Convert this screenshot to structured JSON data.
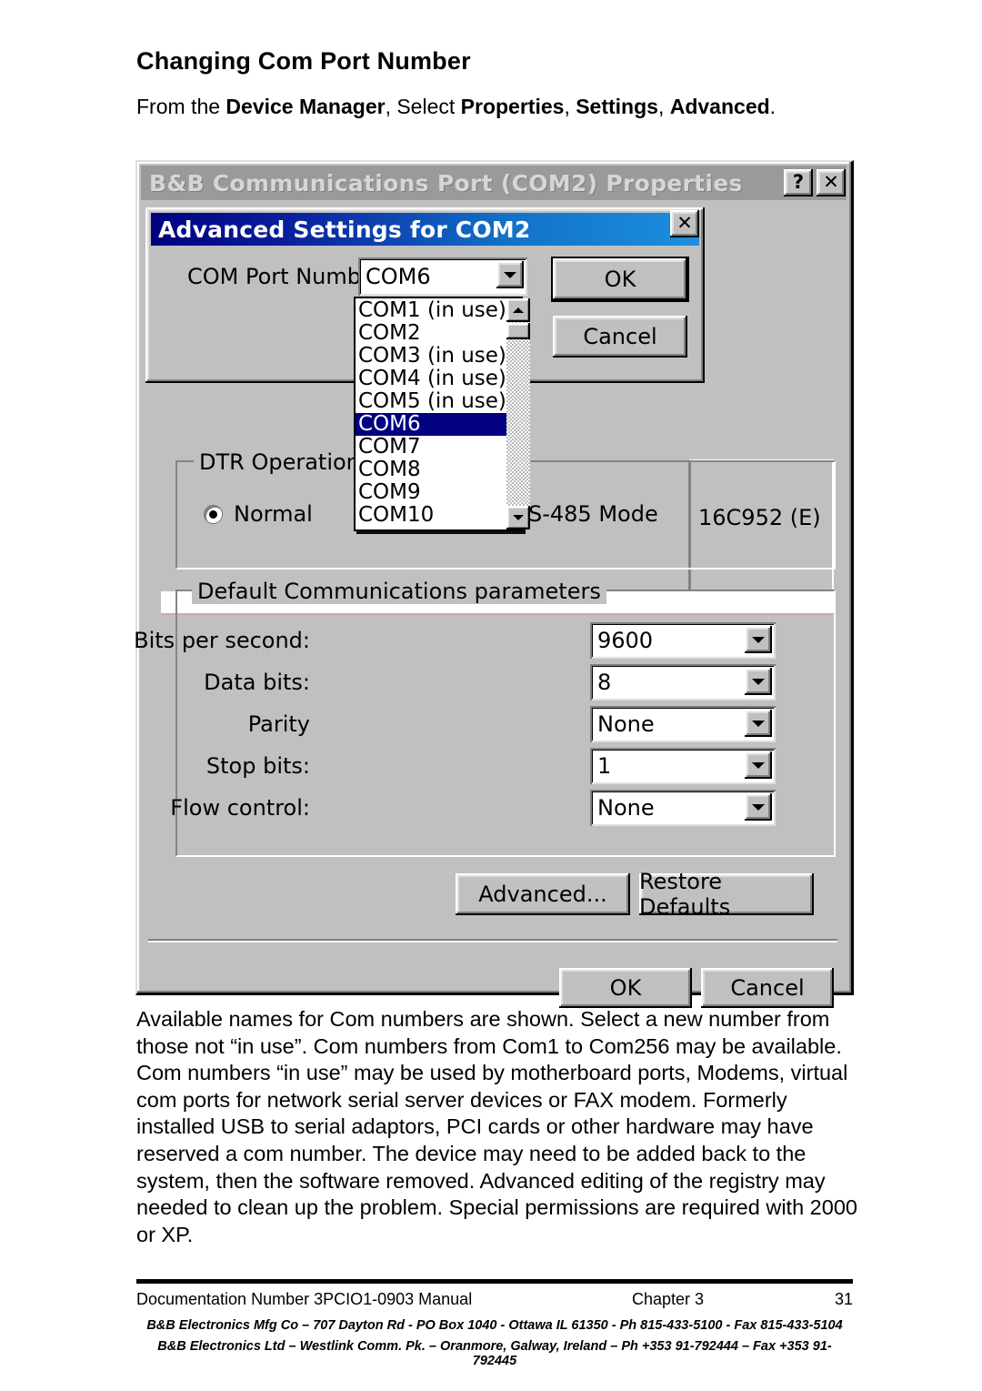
{
  "page": {
    "title": "Changing Com Port Number",
    "intro_plain_1": "From the ",
    "intro_bold_1": "Device Manager",
    "intro_plain_2": ", Select ",
    "intro_bold_2": "Properties",
    "intro_plain_3": ", ",
    "intro_bold_3": "Settings",
    "intro_plain_4": ", ",
    "intro_bold_4": "Advanced",
    "intro_plain_5": ".",
    "body": "Available names for Com numbers are shown. Select a new number from those not “in use”. Com numbers from Com1 to Com256 may be available. Com numbers “in use” may be used by motherboard ports, Modems, virtual com ports for network serial server devices or FAX modem. Formerly installed USB to serial adaptors, PCI cards or other hardware may have reserved a com number. The device may need to be added back to the system, then the software removed. Advanced editing of the registry may needed to clean up the problem. Special permissions are required with 2000 or XP."
  },
  "footer": {
    "doc_number": "Documentation Number 3PCIO1-0903 Manual",
    "chapter": "Chapter 3",
    "page_number": "31",
    "address_us": "B&B Electronics Mfg Co – 707 Dayton Rd - PO Box 1040 - Ottawa IL 61350 - Ph 815-433-5100 - Fax 815-433-5104",
    "address_eu": "B&B Electronics Ltd – Westlink Comm. Pk. – Oranmore, Galway, Ireland – Ph +353 91-792444 – Fax +353 91-792445"
  },
  "outer_dialog": {
    "title": "B&B Communications Port (COM2) Properties",
    "help_button": "?",
    "close_button": "✕",
    "chip_label": "16C952 (E)",
    "dtr_group": {
      "legend": "DTR Operation",
      "radio_normal_label": "Normal",
      "rs485_label": "S-485 Mode"
    },
    "comm_group": {
      "legend": "Default Communications parameters",
      "rows": [
        {
          "label": "Bits per second:",
          "value": "9600"
        },
        {
          "label": "Data bits:",
          "value": "8"
        },
        {
          "label": "Parity",
          "value": "None"
        },
        {
          "label": "Stop bits:",
          "value": "1"
        },
        {
          "label": "Flow control:",
          "value": "None"
        }
      ]
    },
    "advanced_button": "Advanced...",
    "restore_button": "Restore Defaults",
    "ok_button": "OK",
    "cancel_button": "Cancel"
  },
  "inner_dialog": {
    "title": "Advanced Settings for COM2",
    "close_button": "✕",
    "com_port_label": "COM Port Number:",
    "com_port_value": "COM6",
    "ok_button": "OK",
    "cancel_button": "Cancel",
    "dropdown": {
      "selected": "COM6",
      "items": [
        "COM1 (in use)",
        "COM2",
        "COM3 (in use)",
        "COM4 (in use)",
        "COM5 (in use)",
        "COM6",
        "COM7",
        "COM8",
        "COM9",
        "COM10"
      ]
    }
  },
  "colors": {
    "window_face": "#c0c0c0",
    "active_title_start": "#00007e",
    "active_title_end": "#1d8ee0",
    "inactive_title": "#9a9a9a",
    "selection": "#000080"
  }
}
